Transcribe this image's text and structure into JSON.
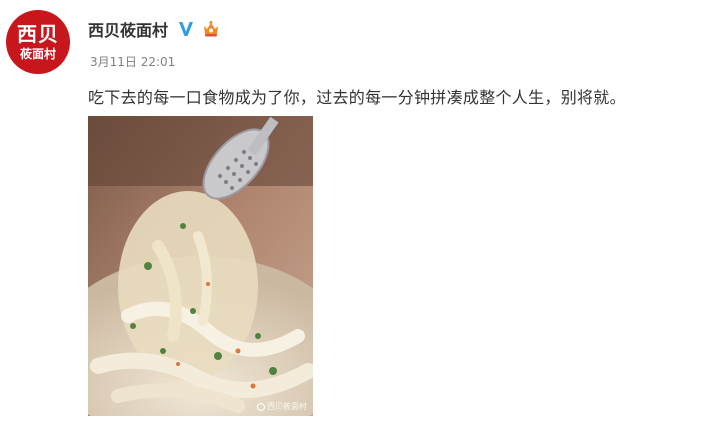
{
  "account": {
    "avatar_line1": "西贝",
    "avatar_line2": "莜面村",
    "name": "西贝莜面村"
  },
  "post": {
    "date": "3月11日",
    "time": "22:01",
    "text": "吃下去的每一口食物成为了你，过去的每一分钟拼凑成整个人生，别将就。",
    "image_watermark": "西贝莜面村"
  },
  "icons": {
    "verified": "verified-v-icon",
    "vip": "vip-crown-icon",
    "watermark": "weibo-logo-icon"
  },
  "colors": {
    "brand_red": "#c8161d",
    "verified_blue": "#2f9ee6",
    "vip_orange": "#f08a24",
    "text": "#333333",
    "meta": "#808080"
  }
}
